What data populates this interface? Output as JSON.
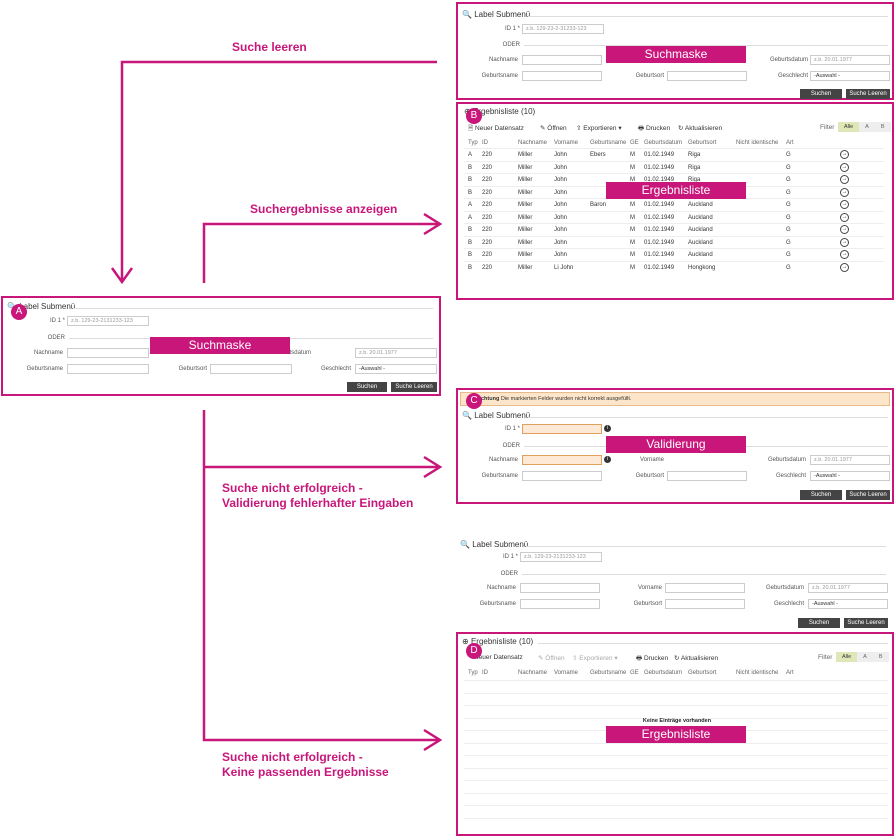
{
  "colors": {
    "accent": "#c8167a"
  },
  "flow_labels": {
    "clear": "Suche leeren",
    "show_results": "Suchergebnisse anzeigen",
    "fail_validation_1": "Suche nicht erfolgreich -",
    "fail_validation_2": "Validierung fehlerhafter Eingaben",
    "fail_empty_1": "Suche nicht erfolgreich -",
    "fail_empty_2": "Keine passenden Ergebnisse"
  },
  "badges": {
    "a": "A",
    "b": "B",
    "c": "C",
    "d": "D"
  },
  "tags": {
    "search_mask": "Suchmaske",
    "result_list": "Ergebnisliste",
    "validation": "Validierung"
  },
  "form": {
    "submenu": "Label Submenü",
    "id_label": "ID 1 *",
    "id_placeholder_a": "z.b. 129-23-2131233-123",
    "id_placeholder_top": "z.b. 129-23-2-31233-123",
    "id_placeholder_d": "z.b. 129-23-2131233-123",
    "oder": "ODER",
    "nachname": "Nachname",
    "vorname": "Vorname",
    "geburtsname": "Geburtsname",
    "geburtsort": "Geburtsort",
    "geburtsdatum": "Geburtsdatum",
    "date_placeholder": "z.b. 20.01.1977",
    "geschlecht": "Geschlecht",
    "auswahl": "-Auswahl -",
    "suchen": "Suchen",
    "suche_leeren": "Suche Leeren"
  },
  "warning": {
    "bold": "Achtung",
    "text": "Die markierten Felder wurden nicht korrekt ausgefüllt."
  },
  "results": {
    "title_b": "Ergebnisliste (10)",
    "title_d": "Ergebnisliste (10)",
    "toolbar": {
      "new": "Neuer Datensatz",
      "open": "Öffnen",
      "export": "Exportieren",
      "print": "Drucken",
      "refresh": "Aktualisieren"
    },
    "filter": {
      "label": "Filter",
      "all": "Alle",
      "a": "A",
      "b": "B"
    },
    "columns": [
      "Typ",
      "ID",
      "Nachname",
      "Vorname",
      "Geburtsname",
      "GE",
      "Geburtsdatum",
      "Geburtsort",
      "Nicht identische",
      "Art"
    ],
    "rows": [
      [
        "A",
        "220",
        "Miller",
        "John",
        "Ebers",
        "M",
        "01.02.1949",
        "Riga",
        "G"
      ],
      [
        "B",
        "220",
        "Miller",
        "John",
        "",
        "M",
        "01.02.1949",
        "Riga",
        "G"
      ],
      [
        "B",
        "220",
        "Miller",
        "John",
        "",
        "M",
        "01.02.1949",
        "Riga",
        "G"
      ],
      [
        "B",
        "220",
        "Miller",
        "John",
        "",
        "M",
        "01.02.1949",
        "Riga",
        "G"
      ],
      [
        "A",
        "220",
        "Miller",
        "John",
        "Baron",
        "M",
        "01.02.1949",
        "Auckland",
        "G"
      ],
      [
        "A",
        "220",
        "Miller",
        "John",
        "",
        "M",
        "01.02.1949",
        "Auckland",
        "G"
      ],
      [
        "B",
        "220",
        "Miller",
        "John",
        "",
        "M",
        "01.02.1949",
        "Auckland",
        "G"
      ],
      [
        "B",
        "220",
        "Miller",
        "John",
        "",
        "M",
        "01.02.1949",
        "Auckland",
        "G"
      ],
      [
        "B",
        "220",
        "Miller",
        "John",
        "",
        "M",
        "01.02.1949",
        "Auckland",
        "G"
      ],
      [
        "B",
        "220",
        "Miller",
        "Li John",
        "",
        "M",
        "01.02.1949",
        "Hongkong",
        "G"
      ]
    ],
    "empty": "Keine Einträge vorhanden"
  }
}
